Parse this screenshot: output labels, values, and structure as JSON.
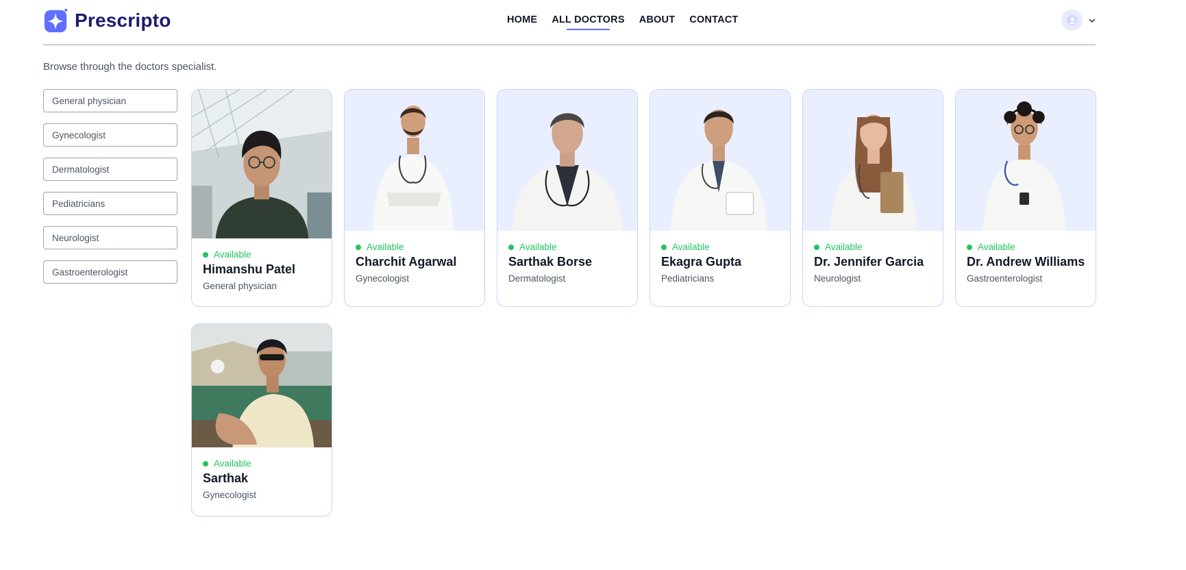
{
  "brand": {
    "name": "Prescripto",
    "color": "#5f6fff"
  },
  "nav": [
    {
      "label": "HOME",
      "active": false
    },
    {
      "label": "ALL DOCTORS",
      "active": true
    },
    {
      "label": "ABOUT",
      "active": false
    },
    {
      "label": "CONTACT",
      "active": false
    }
  ],
  "profile": {
    "avatar_icon": "user-avatar-icon",
    "menu_icon": "chevron-down-icon"
  },
  "intro": "Browse through the doctors specialist.",
  "filters": [
    "General physician",
    "Gynecologist",
    "Dermatologist",
    "Pediatricians",
    "Neurologist",
    "Gastroenterologist"
  ],
  "doctors": [
    {
      "name": "Himanshu Patel",
      "speciality": "General physician",
      "status": "Available"
    },
    {
      "name": "Charchit Agarwal",
      "speciality": "Gynecologist",
      "status": "Available"
    },
    {
      "name": "Sarthak Borse",
      "speciality": "Dermatologist",
      "status": "Available"
    },
    {
      "name": "Ekagra Gupta",
      "speciality": "Pediatricians",
      "status": "Available"
    },
    {
      "name": "Dr. Jennifer Garcia",
      "speciality": "Neurologist",
      "status": "Available"
    },
    {
      "name": "Dr. Andrew Williams",
      "speciality": "Gastroenterologist",
      "status": "Available"
    },
    {
      "name": "Sarthak",
      "speciality": "Gynecologist",
      "status": "Available"
    }
  ],
  "colors": {
    "available": "#22c55e",
    "card_border": "#c7d2fe",
    "photo_bg": "#eaefff"
  }
}
